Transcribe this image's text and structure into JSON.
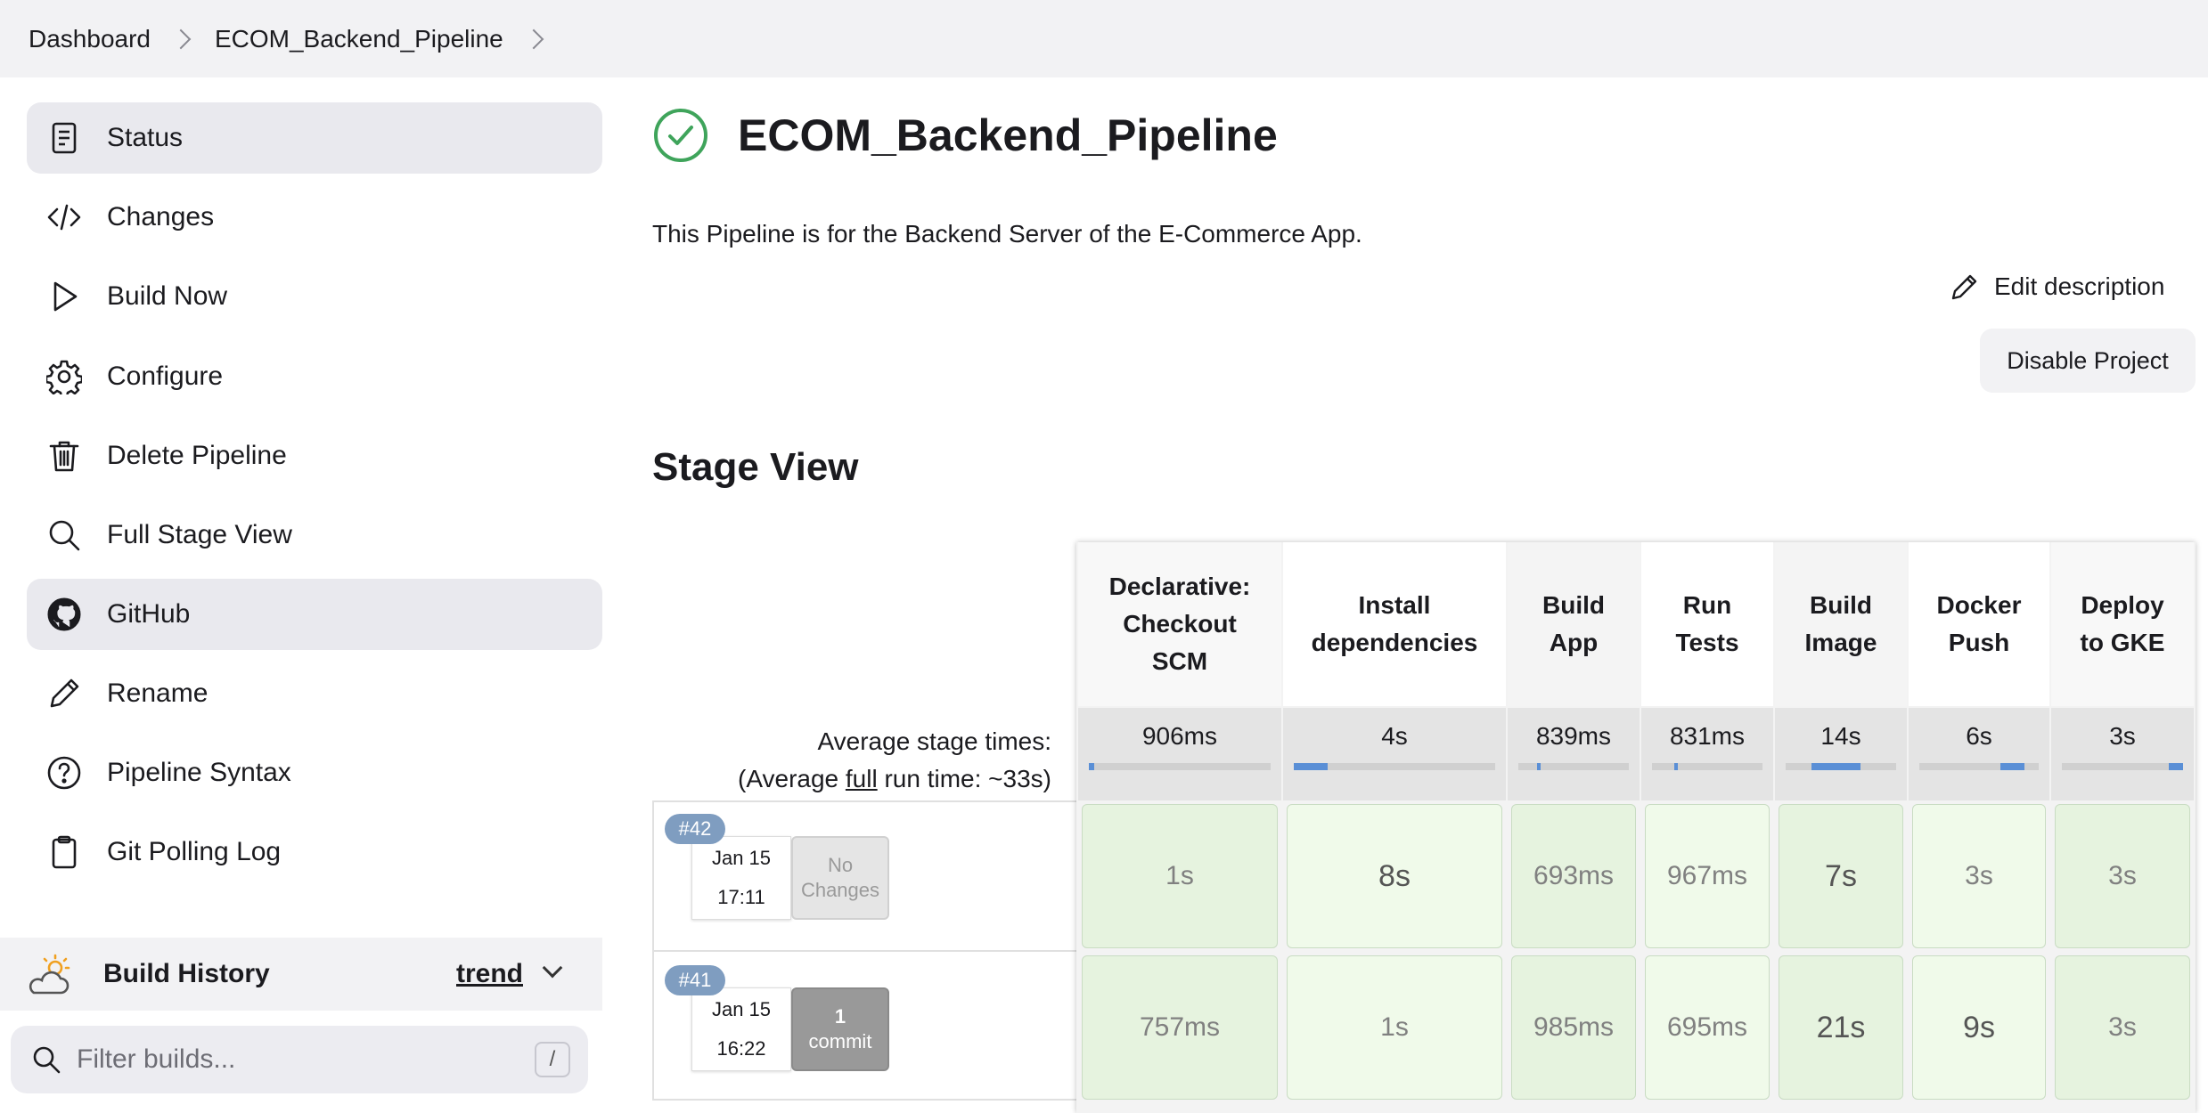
{
  "breadcrumb": [
    "Dashboard",
    "ECOM_Backend_Pipeline"
  ],
  "sidebar": {
    "items": [
      {
        "label": "Status",
        "icon": "document-icon",
        "active": true
      },
      {
        "label": "Changes",
        "icon": "code-icon",
        "active": false
      },
      {
        "label": "Build Now",
        "icon": "play-icon",
        "active": false
      },
      {
        "label": "Configure",
        "icon": "gear-icon",
        "active": false
      },
      {
        "label": "Delete Pipeline",
        "icon": "trash-icon",
        "active": false
      },
      {
        "label": "Full Stage View",
        "icon": "search-icon",
        "active": false
      },
      {
        "label": "GitHub",
        "icon": "github-icon",
        "active": true
      },
      {
        "label": "Rename",
        "icon": "pencil-icon",
        "active": false
      },
      {
        "label": "Pipeline Syntax",
        "icon": "question-icon",
        "active": false
      },
      {
        "label": "Git Polling Log",
        "icon": "clipboard-icon",
        "active": false
      }
    ]
  },
  "build_history": {
    "title": "Build History",
    "trend_label": "trend",
    "filter_placeholder": "Filter builds...",
    "filter_shortcut": "/"
  },
  "main": {
    "title": "ECOM_Backend_Pipeline",
    "description": "This Pipeline is for the Backend Server of the E-Commerce App.",
    "edit_description": "Edit description",
    "disable_project": "Disable Project",
    "stage_view_title": "Stage View"
  },
  "stage_view": {
    "average_label": "Average stage times:",
    "average_full_prefix": "(Average ",
    "average_full_link": "full",
    "average_full_suffix": " run time: ~33s)",
    "stages": [
      {
        "name": "Declarative: Checkout SCM",
        "avg": "906ms",
        "bar_start": 0.0,
        "bar_fraction": 0.03
      },
      {
        "name": "Install dependencies",
        "avg": "4s",
        "bar_start": 0.0,
        "bar_fraction": 0.17
      },
      {
        "name": "Build App",
        "avg": "839ms",
        "bar_start": 0.17,
        "bar_fraction": 0.03
      },
      {
        "name": "Run Tests",
        "avg": "831ms",
        "bar_start": 0.2,
        "bar_fraction": 0.03
      },
      {
        "name": "Build Image",
        "avg": "14s",
        "bar_start": 0.23,
        "bar_fraction": 0.45
      },
      {
        "name": "Docker Push",
        "avg": "6s",
        "bar_start": 0.68,
        "bar_fraction": 0.2
      },
      {
        "name": "Deploy to GKE",
        "avg": "3s",
        "bar_start": 0.88,
        "bar_fraction": 0.12
      }
    ],
    "runs": [
      {
        "number": "#42",
        "date": "Jan 15",
        "time": "17:11",
        "changes_line1": "No",
        "changes_line2": "Changes",
        "changes_type": "none",
        "cells": [
          "1s",
          "8s",
          "693ms",
          "967ms",
          "7s",
          "3s",
          "3s"
        ]
      },
      {
        "number": "#41",
        "date": "Jan 15",
        "time": "16:22",
        "changes_line1": "1",
        "changes_line2": "commit",
        "changes_type": "commit",
        "cells": [
          "757ms",
          "1s",
          "985ms",
          "695ms",
          "21s",
          "9s",
          "3s"
        ]
      }
    ]
  },
  "colors": {
    "success": "#3fa45b",
    "cell_light": "#f0faea",
    "cell_dark": "#e6f3df",
    "bar": "#5a8fd6",
    "badge": "#7f9dc0"
  }
}
